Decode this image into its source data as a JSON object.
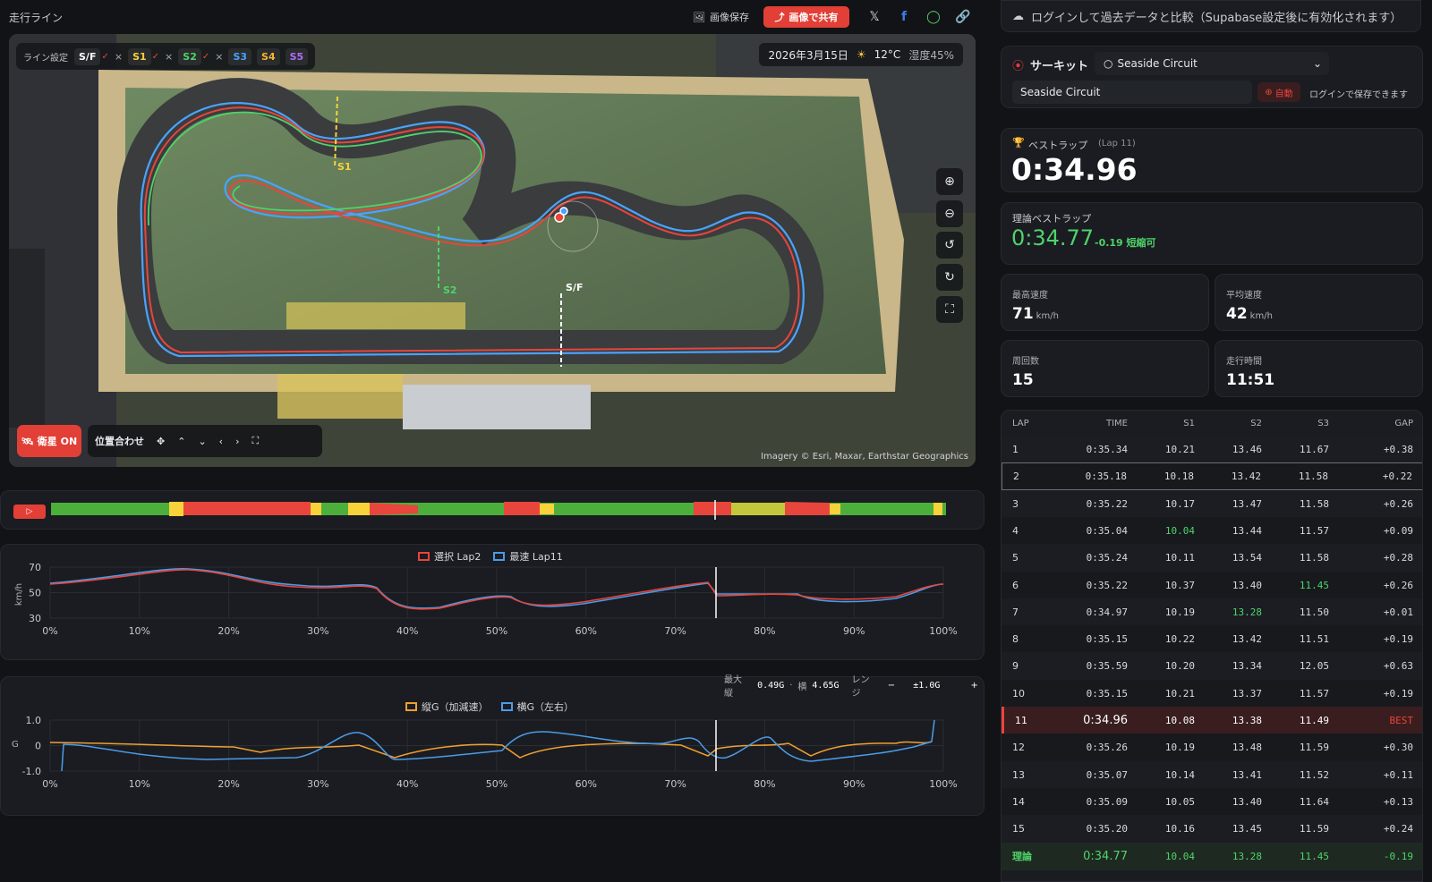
{
  "topbar": {
    "title": "走行ライン",
    "save_image": "画像保存",
    "share_image": "画像で共有",
    "share_icons": [
      "x-icon",
      "facebook-icon",
      "whatsapp-icon",
      "link-icon"
    ]
  },
  "map": {
    "line_settings_label": "ライン設定",
    "chips": [
      {
        "label": "S/F",
        "color": "#ffffff",
        "checked": true
      },
      {
        "label": "S1",
        "color": "#f7d23a",
        "checked": true
      },
      {
        "label": "S2",
        "color": "#4fd36a",
        "checked": true
      },
      {
        "label": "S3",
        "color": "#4aa3ff",
        "checked": false
      },
      {
        "label": "S4",
        "color": "#f5b62f",
        "checked": false
      },
      {
        "label": "S5",
        "color": "#b06bff",
        "checked": false
      }
    ],
    "weather": {
      "date": "2026年3月15日",
      "temp": "12°C",
      "humidity": "湿度45%"
    },
    "sector_labels": {
      "s1": "S1",
      "s2": "S2",
      "sf": "S/F"
    },
    "satellite_label": "衛星 ON",
    "align_label": "位置合わせ",
    "attribution": "Imagery © Esri, Maxar, Earthstar Geographics"
  },
  "speed_chart": {
    "legend": [
      {
        "name": "選択 Lap2",
        "color": "#e8453c"
      },
      {
        "name": "最速 Lap11",
        "color": "#4c9be8"
      }
    ],
    "ylabel": "km/h",
    "yticks": [
      "70",
      "50",
      "30"
    ],
    "xticks": [
      "0%",
      "10%",
      "20%",
      "30%",
      "40%",
      "50%",
      "60%",
      "70%",
      "80%",
      "90%",
      "100%"
    ]
  },
  "g_chart": {
    "info_label": "最大 縦",
    "max_long": "0.49G",
    "lat_label": "横",
    "max_lat": "4.65G",
    "range_label": "レンジ",
    "range_value": "±1.0G",
    "legend": [
      {
        "name": "縦G（加減速）",
        "color": "#f0a030"
      },
      {
        "name": "横G（左右）",
        "color": "#4c9be8"
      }
    ],
    "ylabel": "G",
    "yticks": [
      "1.0",
      "0",
      "-1.0"
    ],
    "xticks": [
      "0%",
      "10%",
      "20%",
      "30%",
      "40%",
      "50%",
      "60%",
      "70%",
      "80%",
      "90%",
      "100%"
    ]
  },
  "right": {
    "login_text": "ログインして過去データと比較（Supabase設定後に有効化されます）",
    "circuit_label": "サーキット",
    "circuit_select": "Seaside Circuit",
    "circuit_name": "Seaside Circuit",
    "auto_label": "自動",
    "save_note": "ログインで保存できます",
    "best_label": "ベストラップ",
    "best_lap_note": "(Lap 11)",
    "best_time": "0:34.96",
    "theory_label": "理論ベストラップ",
    "theory_time": "0:34.77",
    "theory_diff": "-0.19 短縮可",
    "stats": [
      {
        "label": "最高速度",
        "value": "71",
        "unit": "km/h"
      },
      {
        "label": "平均速度",
        "value": "42",
        "unit": "km/h"
      },
      {
        "label": "周回数",
        "value": "15",
        "unit": ""
      },
      {
        "label": "走行時間",
        "value": "11:51",
        "unit": ""
      }
    ]
  },
  "laps": {
    "headers": {
      "lap": "LAP",
      "time": "TIME",
      "s1": "S1",
      "s2": "S2",
      "s3": "S3",
      "gap": "GAP"
    },
    "rows": [
      {
        "lap": "1",
        "time": "0:35.34",
        "s1": "10.21",
        "s2": "13.46",
        "s3": "11.67",
        "gap": "+0.38"
      },
      {
        "lap": "2",
        "time": "0:35.18",
        "s1": "10.18",
        "s2": "13.42",
        "s3": "11.58",
        "gap": "+0.22"
      },
      {
        "lap": "3",
        "time": "0:35.22",
        "s1": "10.17",
        "s2": "13.47",
        "s3": "11.58",
        "gap": "+0.26"
      },
      {
        "lap": "4",
        "time": "0:35.04",
        "s1": "10.04",
        "s2": "13.44",
        "s3": "11.57",
        "gap": "+0.09"
      },
      {
        "lap": "5",
        "time": "0:35.24",
        "s1": "10.11",
        "s2": "13.54",
        "s3": "11.58",
        "gap": "+0.28"
      },
      {
        "lap": "6",
        "time": "0:35.22",
        "s1": "10.37",
        "s2": "13.40",
        "s3": "11.45",
        "gap": "+0.26"
      },
      {
        "lap": "7",
        "time": "0:34.97",
        "s1": "10.19",
        "s2": "13.28",
        "s3": "11.50",
        "gap": "+0.01"
      },
      {
        "lap": "8",
        "time": "0:35.15",
        "s1": "10.22",
        "s2": "13.42",
        "s3": "11.51",
        "gap": "+0.19"
      },
      {
        "lap": "9",
        "time": "0:35.59",
        "s1": "10.20",
        "s2": "13.34",
        "s3": "12.05",
        "gap": "+0.63"
      },
      {
        "lap": "10",
        "time": "0:35.15",
        "s1": "10.21",
        "s2": "13.37",
        "s3": "11.57",
        "gap": "+0.19"
      },
      {
        "lap": "11",
        "time": "0:34.96",
        "s1": "10.08",
        "s2": "13.38",
        "s3": "11.49",
        "gap": "BEST"
      },
      {
        "lap": "12",
        "time": "0:35.26",
        "s1": "10.19",
        "s2": "13.48",
        "s3": "11.59",
        "gap": "+0.30"
      },
      {
        "lap": "13",
        "time": "0:35.07",
        "s1": "10.14",
        "s2": "13.41",
        "s3": "11.52",
        "gap": "+0.11"
      },
      {
        "lap": "14",
        "time": "0:35.09",
        "s1": "10.05",
        "s2": "13.40",
        "s3": "11.64",
        "gap": "+0.13"
      },
      {
        "lap": "15",
        "time": "0:35.20",
        "s1": "10.16",
        "s2": "13.45",
        "s3": "11.59",
        "gap": "+0.24"
      }
    ],
    "theory_row": {
      "lap": "理論",
      "time": "0:34.77",
      "s1": "10.04",
      "s2": "13.28",
      "s3": "11.45",
      "gap": "-0.19"
    },
    "selected_lap": "2",
    "best_lap": "11",
    "best_sectors": {
      "s1": "10.04",
      "s2": "13.28",
      "s3": "11.45"
    }
  },
  "colors": {
    "accent_red": "#e23f36",
    "green": "#4fd36a",
    "best_bg": "#3a1d1f"
  }
}
